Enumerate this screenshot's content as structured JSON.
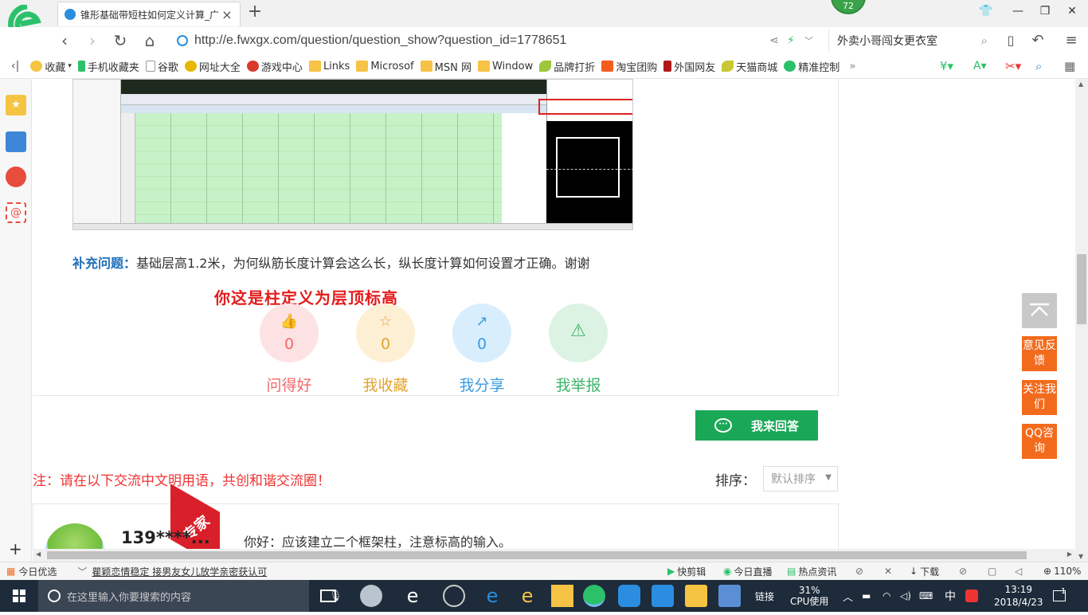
{
  "browser": {
    "tab_title": "锥形基础带短柱如何定义计算_广",
    "badge_number": "72",
    "url": "http://e.fwxgx.com/question/question_show?question_id=1778651",
    "search_text": "外卖小哥闯女更衣室"
  },
  "bookmarks": [
    {
      "label": "收藏",
      "icon": "star-icon"
    },
    {
      "label": "手机收藏夹",
      "icon": "phone-icon"
    },
    {
      "label": "谷歌",
      "icon": "page-icon"
    },
    {
      "label": "网址大全",
      "icon": "globe-icon"
    },
    {
      "label": "游戏中心",
      "icon": "game-icon"
    },
    {
      "label": "Links",
      "icon": "folder-icon"
    },
    {
      "label": "Microsof",
      "icon": "folder-icon"
    },
    {
      "label": "MSN 网",
      "icon": "folder-icon"
    },
    {
      "label": "Window",
      "icon": "folder-icon"
    },
    {
      "label": "品牌打折",
      "icon": "leaf-icon"
    },
    {
      "label": "淘宝团购",
      "icon": "taobao-icon"
    },
    {
      "label": "外国网友",
      "icon": "bookmark-icon"
    },
    {
      "label": "天猫商城",
      "icon": "leaf-icon"
    },
    {
      "label": "精准控制",
      "icon": "chat-icon"
    }
  ],
  "question": {
    "supplement_label": "补充问题：",
    "supplement_text": "基础层高1.2米，为何纵筋长度计算会这么长，纵长度计算如何设置才正确。谢谢",
    "annotation": "你这是柱定义为层顶标高",
    "actions": [
      {
        "label": "问得好",
        "count": "0",
        "icon": "thumbs-up-icon",
        "color": "#f06a6a",
        "bg": "#fde2e4"
      },
      {
        "label": "我收藏",
        "count": "0",
        "icon": "star-outline-icon",
        "color": "#e0a52f",
        "bg": "#fdefd4"
      },
      {
        "label": "我分享",
        "count": "0",
        "icon": "share-icon",
        "color": "#3c9be0",
        "bg": "#d9eefc"
      },
      {
        "label": "我举报",
        "count": "",
        "icon": "warning-icon",
        "color": "#3fb36b",
        "bg": "#dcf3e3"
      }
    ],
    "answer_button": "我来回答"
  },
  "comments": {
    "notice": "注：请在以下交流中文明用语，共创和谐交流圈！",
    "sort_label": "排序：",
    "sort_value": "默认排序"
  },
  "answer": {
    "ribbon": "专家",
    "user": "139****...",
    "text": "你好：应该建立二个框架柱，注意标高的输入。"
  },
  "float_buttons": [
    "意见反馈",
    "关注我们",
    "QQ咨询"
  ],
  "statusbar": {
    "left1": "今日优选",
    "news": "瞿颖恋情稳定 接男友女儿放学亲密获认可",
    "kuaijianji": "快剪辑",
    "live": "今日直播",
    "hot": "热点资讯",
    "download": "下载",
    "zoom": "110%"
  },
  "taskbar": {
    "search_placeholder": "在这里输入你要搜索的内容",
    "links": "链接",
    "cpu_percent": "31%",
    "cpu_label": "CPU使用",
    "ime": "中",
    "time": "13:19",
    "date": "2018/4/23",
    "notif_count": "1"
  }
}
